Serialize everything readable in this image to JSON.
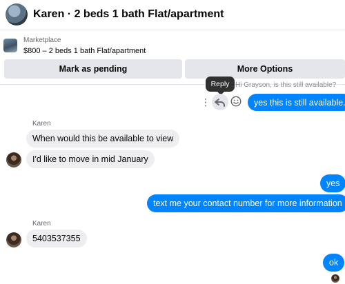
{
  "header": {
    "title": "Karen · 2 beds 1 bath Flat/apartment"
  },
  "listing": {
    "category": "Marketplace",
    "title": "$800 – 2 beds 1 bath Flat/apartment"
  },
  "actions": {
    "mark_pending": "Mark as pending",
    "more_options": "More Options"
  },
  "tooltip": {
    "reply": "Reply"
  },
  "conversation": {
    "quoted_message": "Hi Grayson, is this still available?",
    "messages": [
      {
        "sender": "me",
        "text": "yes this is still available."
      },
      {
        "sender": "Karen",
        "text": "When would this be available to view"
      },
      {
        "sender": "Karen",
        "text": "I'd like to move in mid January"
      },
      {
        "sender": "me",
        "text": "yes"
      },
      {
        "sender": "me",
        "text": "text me your contact number for more information"
      },
      {
        "sender": "Karen",
        "text": "5403537355"
      },
      {
        "sender": "me",
        "text": "ok"
      }
    ],
    "sender_names": {
      "group1": "Karen",
      "group2": "Karen"
    }
  },
  "icons": {
    "more": "more-vertical-icon",
    "reply": "reply-icon",
    "react": "emoji-icon"
  }
}
